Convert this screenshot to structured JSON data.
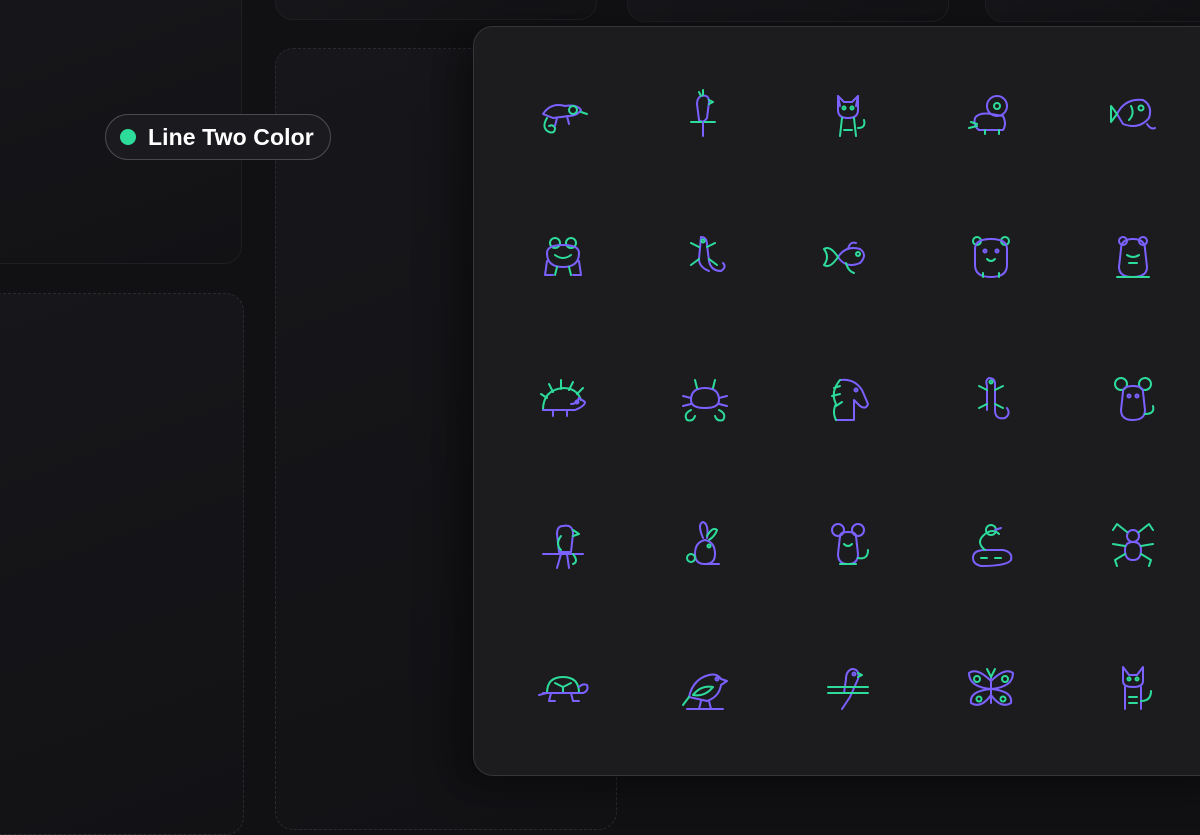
{
  "badge": {
    "label": "Line Two Color"
  },
  "colors": {
    "accent_green": "#2ddc9a",
    "accent_purple": "#7b61ff",
    "background": "#111114",
    "card": "#1c1c1f"
  },
  "icons": [
    "chameleon-icon",
    "parrot-on-perch-icon",
    "cat-icon",
    "ferret-icon",
    "fish-icon",
    "frog-icon",
    "lizard-icon",
    "goldfish-icon",
    "hamster-icon",
    "guinea-pig-icon",
    "hedgehog-icon",
    "crab-icon",
    "horse-icon",
    "gecko-icon",
    "mouse-icon",
    "parrot-icon",
    "rabbit-icon",
    "rat-icon",
    "snake-icon",
    "spider-icon",
    "turtle-icon",
    "bird-icon",
    "parakeet-icon",
    "butterfly-icon",
    "kitten-icon"
  ]
}
